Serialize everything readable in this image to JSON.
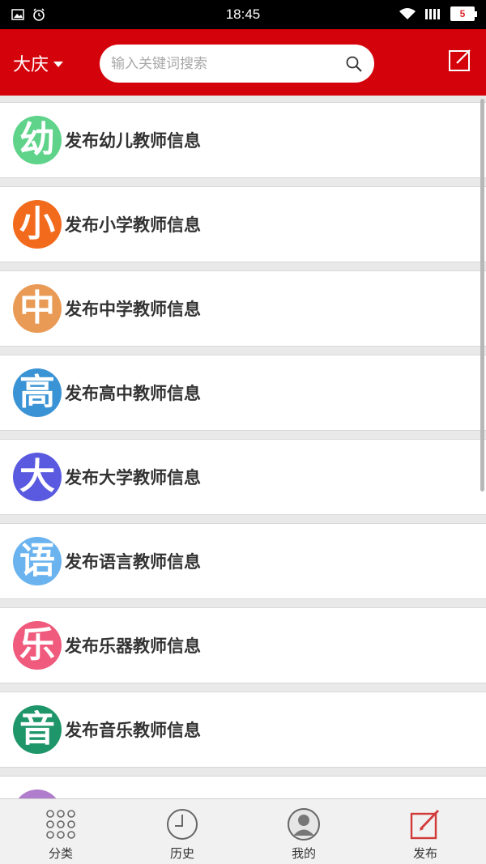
{
  "status_bar": {
    "time": "18:45",
    "battery": "5"
  },
  "header": {
    "city": "大庆",
    "search_placeholder": "输入关键词搜索"
  },
  "list": {
    "items": [
      {
        "label": "发布幼儿教师信息",
        "avatar_char": "幼",
        "color": "#5fd38a"
      },
      {
        "label": "发布小学教师信息",
        "avatar_char": "小",
        "color": "#f26b1d"
      },
      {
        "label": "发布中学教师信息",
        "avatar_char": "中",
        "color": "#e99a55"
      },
      {
        "label": "发布高中教师信息",
        "avatar_char": "高",
        "color": "#3a93d4"
      },
      {
        "label": "发布大学教师信息",
        "avatar_char": "大",
        "color": "#5a5ae0"
      },
      {
        "label": "发布语言教师信息",
        "avatar_char": "语",
        "color": "#6ab3ef"
      },
      {
        "label": "发布乐器教师信息",
        "avatar_char": "乐",
        "color": "#ef5a7d"
      },
      {
        "label": "发布音乐教师信息",
        "avatar_char": "音",
        "color": "#1f9669"
      },
      {
        "label": "",
        "avatar_char": "",
        "color": "#b07ccc"
      }
    ]
  },
  "tabbar": {
    "tabs": [
      {
        "label": "分类",
        "icon": "grid-icon"
      },
      {
        "label": "历史",
        "icon": "clock-icon"
      },
      {
        "label": "我的",
        "icon": "user-icon"
      },
      {
        "label": "发布",
        "icon": "publish-icon"
      }
    ]
  },
  "colors": {
    "brand": "#d4020b",
    "publish_accent": "#d23a3a"
  }
}
